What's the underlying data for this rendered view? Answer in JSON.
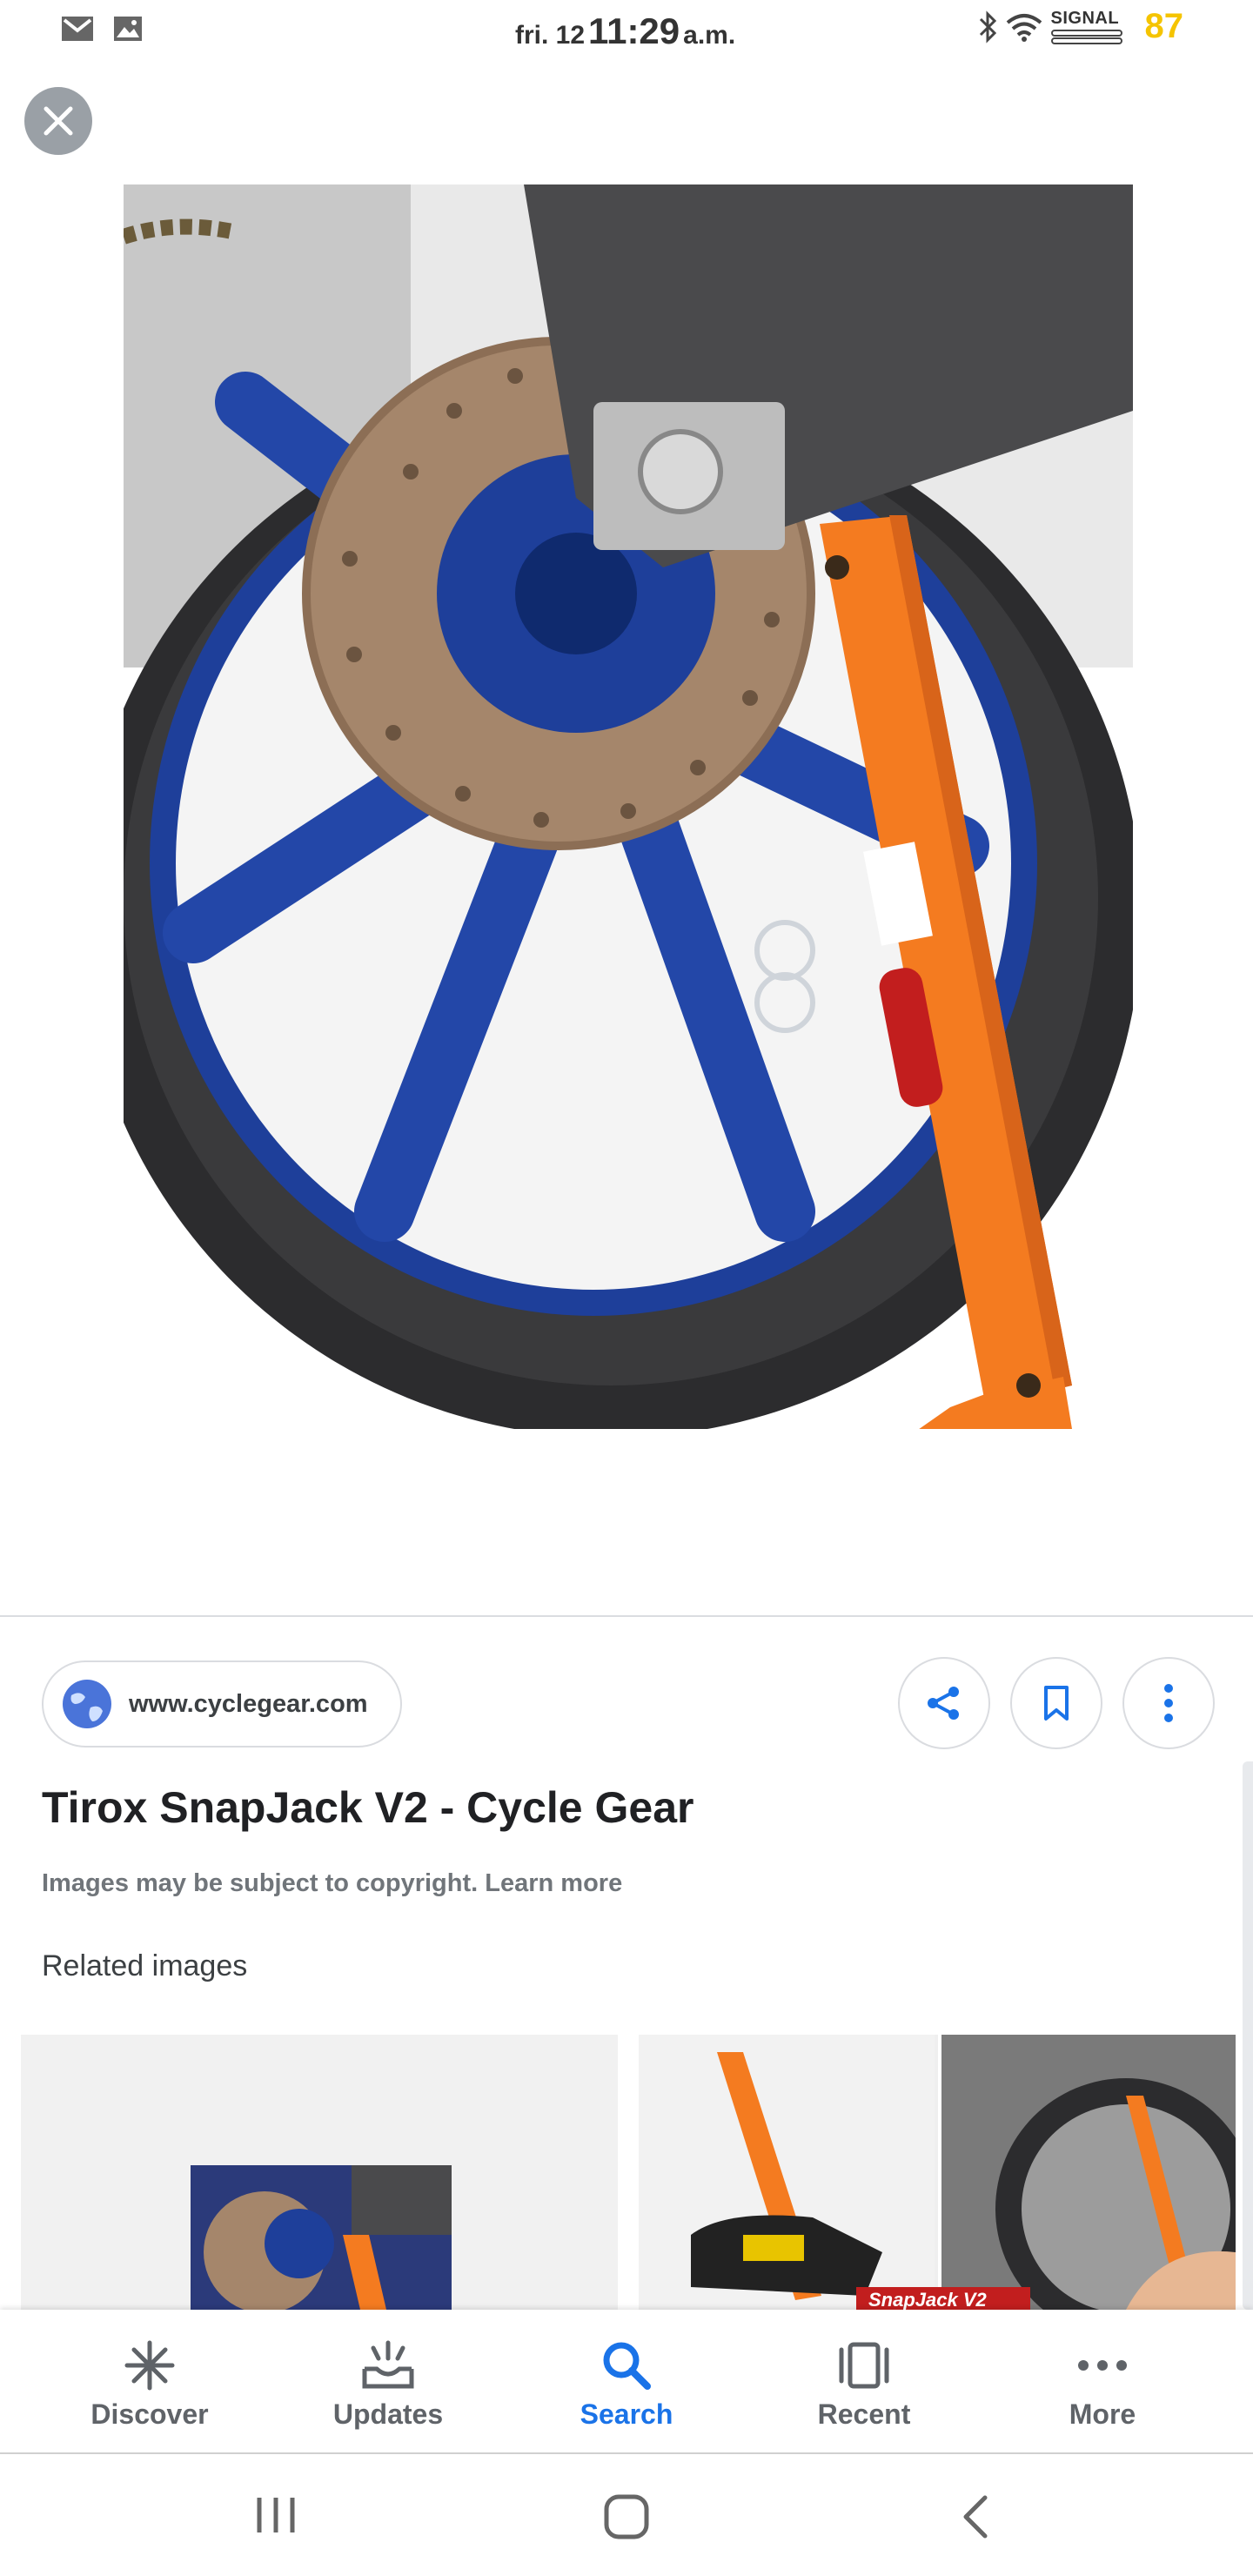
{
  "status_bar": {
    "day": "fri. 12",
    "time": "11:29",
    "ampm": "a.m.",
    "signal_label": "SIGNAL",
    "battery": "87",
    "icons": [
      "gmail-icon",
      "gallery-icon",
      "bluetooth-icon",
      "wifi-icon",
      "signal-icon"
    ]
  },
  "viewer": {
    "close_icon": "close-icon",
    "image_subject": "orange motorcycle stand on rear wheel"
  },
  "result": {
    "source_domain": "www.cyclegear.com",
    "title": "Tirox SnapJack V2 - Cycle Gear",
    "copyright_text": "Images may be subject to copyright.",
    "learn_more": "Learn more",
    "actions": [
      "share-icon",
      "bookmark-icon",
      "more-vert-icon"
    ]
  },
  "related": {
    "heading": "Related images",
    "thumb2_caption": "SnapJack V2"
  },
  "bottom_nav": {
    "items": [
      {
        "label": "Discover",
        "icon": "asterisk-icon"
      },
      {
        "label": "Updates",
        "icon": "updates-tray-icon"
      },
      {
        "label": "Search",
        "icon": "search-icon",
        "active": true
      },
      {
        "label": "Recent",
        "icon": "recent-cards-icon"
      },
      {
        "label": "More",
        "icon": "more-horiz-icon"
      }
    ]
  },
  "system_nav": [
    "recents-icon",
    "home-icon",
    "back-icon"
  ],
  "colors": {
    "accent": "#1a73e8",
    "battery": "#f5c400",
    "stand_orange": "#f47b20",
    "wheel_blue": "#1e3f9a"
  }
}
